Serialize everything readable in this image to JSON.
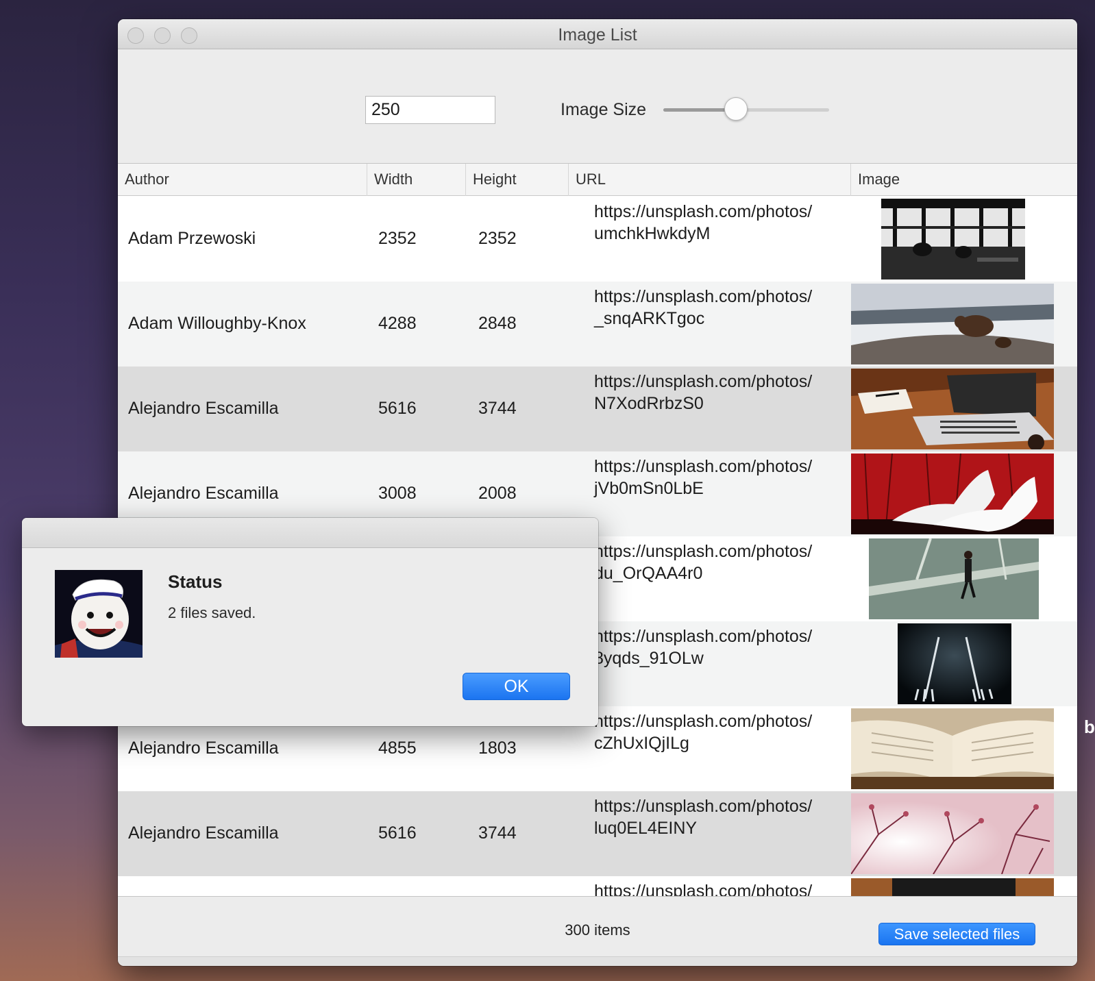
{
  "window": {
    "title": "Image List"
  },
  "toolbar": {
    "size_value": "250",
    "size_label": "Image Size",
    "slider_fraction": 0.44
  },
  "table": {
    "columns": [
      "Author",
      "Width",
      "Height",
      "URL",
      "Image"
    ],
    "rows": [
      {
        "author": "Adam Przewoski",
        "width": "2352",
        "height": "2352",
        "url": "https://unsplash.com/photos/\numchkHwkdyM",
        "image": "bw-cafe-window-photo"
      },
      {
        "author": "Adam Willoughby-Knox",
        "width": "4288",
        "height": "2848",
        "url": "https://unsplash.com/photos/\n_snqARKTgoc",
        "image": "bear-on-rocks-photo"
      },
      {
        "author": "Alejandro Escamilla",
        "width": "5616",
        "height": "3744",
        "url": "https://unsplash.com/photos/\nN7XodRrbzS0",
        "image": "laptop-desk-photo"
      },
      {
        "author": "Alejandro Escamilla",
        "width": "3008",
        "height": "2008",
        "url": "https://unsplash.com/photos/\njVb0mSn0LbE",
        "image": "white-heels-photo"
      },
      {
        "author": "",
        "width": "",
        "height": "",
        "url": "https://unsplash.com/photos/\ndu_OrQAA4r0",
        "image": "man-walking-road-photo"
      },
      {
        "author": "",
        "width": "",
        "height": "",
        "url": "https://unsplash.com/photos/\n8yqds_91OLw",
        "image": "forks-dark-photo"
      },
      {
        "author": "Alejandro Escamilla",
        "width": "4855",
        "height": "1803",
        "url": "https://unsplash.com/photos/\ncZhUxIQjILg",
        "image": "open-book-photo"
      },
      {
        "author": "Alejandro Escamilla",
        "width": "5616",
        "height": "3744",
        "url": "https://unsplash.com/photos/\nluq0EL4EINY",
        "image": "pink-branches-photo"
      },
      {
        "author": "",
        "width": "",
        "height": "",
        "url": "https://unsplash.com/photos/",
        "image": "partial-photo"
      }
    ]
  },
  "footer": {
    "count": "300 items",
    "save_label": "Save selected files"
  },
  "dialog": {
    "heading": "Status",
    "message": "2 files saved.",
    "ok_label": "OK",
    "icon": "stay-puft-icon"
  },
  "background": {
    "edge_text": "b"
  },
  "colors": {
    "accent": "#1a74f0",
    "selected_row": "#dcdcdc"
  }
}
